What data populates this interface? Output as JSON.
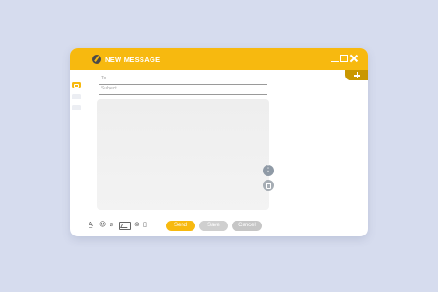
{
  "window": {
    "title": "NEW MESSAGE",
    "controls": [
      "minimize-icon",
      "maximize-icon",
      "close-icon"
    ],
    "add_tab_icon": "plus-icon"
  },
  "sidebar": {
    "items": [
      {
        "icon": "mail-icon",
        "active": true
      },
      {
        "icon": "folder-icon",
        "active": false
      },
      {
        "icon": "folder-icon",
        "active": false
      }
    ]
  },
  "compose": {
    "to_label": "To",
    "subject_label": "Subject",
    "body_value": ""
  },
  "floating_actions": [
    "more-vertical-icon",
    "trash-icon"
  ],
  "toolbar": {
    "icons": [
      "text-format-icon",
      "emoji-icon",
      "attach-icon",
      "image-icon",
      "link-icon",
      "delete-icon"
    ]
  },
  "buttons": {
    "send": "Send",
    "save": "Save",
    "cancel": "Cancel"
  },
  "colors": {
    "accent": "#f7b90f",
    "accent_dark": "#c99700",
    "background": "#d6dcee",
    "disabled_button": "#cfcfcf"
  }
}
